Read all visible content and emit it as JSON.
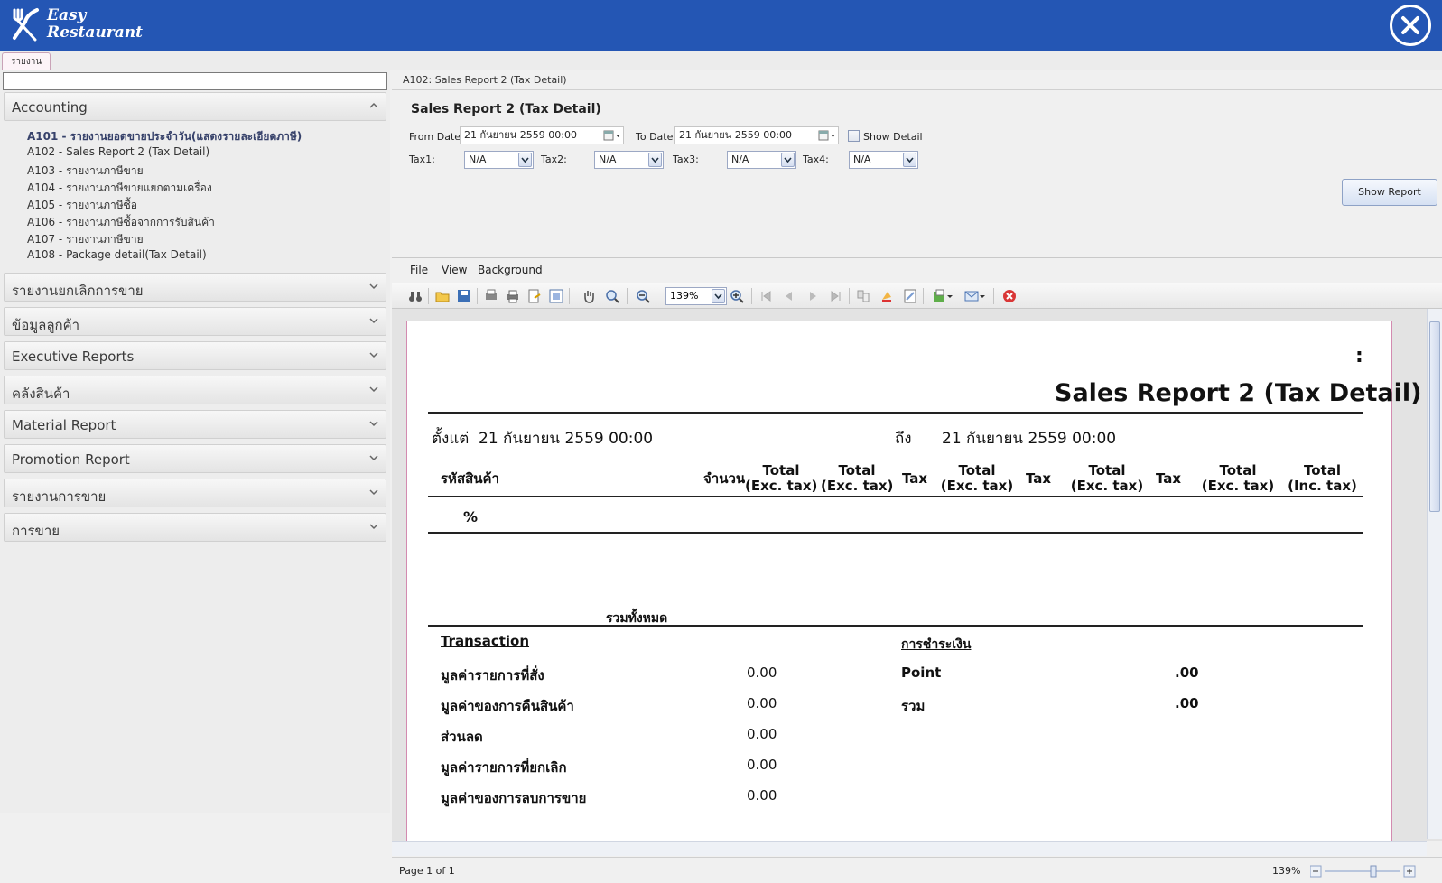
{
  "app": {
    "logo_line1": "Easy",
    "logo_line2": "Restaurant"
  },
  "tabs": [
    "รายงาน"
  ],
  "search": {
    "value": ""
  },
  "accordion": {
    "accounting": {
      "label": "Accounting",
      "items": [
        "A101 - รายงานยอดขายประจำวัน(แสดงรายละเอียดภาษี)",
        "A102 - Sales Report 2 (Tax Detail)",
        "A103 - รายงานภาษีขาย",
        "A104 - รายงานภาษีขายแยกตามเครื่อง",
        "A105 - รายงานภาษีซื้อ",
        "A106 - รายงานภาษีซื้อจากการรับสินค้า",
        "A107 - รายงานภาษีขาย",
        "A108 - Package detail(Tax Detail)"
      ]
    },
    "sections": [
      "รายงานยกเลิกการขาย",
      "ข้อมูลลูกค้า",
      "Executive Reports",
      "คลังสินค้า",
      "Material Report",
      "Promotion Report",
      "รายงานการขาย",
      "การขาย"
    ]
  },
  "report_header": {
    "breadcrumb": "A102: Sales Report 2 (Tax Detail)",
    "title": "Sales Report 2 (Tax Detail)",
    "from_label": "From Date:",
    "from_value": "21  กันยายน      2559  00:00",
    "to_label": "To Date:",
    "to_value": "21  กันยายน      2559  00:00",
    "show_detail_label": "Show Detail",
    "show_detail_checked": false,
    "tax1_label": "Tax1:",
    "tax1_value": "N/A",
    "tax2_label": "Tax2:",
    "tax2_value": "N/A",
    "tax3_label": "Tax3:",
    "tax3_value": "N/A",
    "tax4_label": "Tax4:",
    "tax4_value": "N/A",
    "show_report_button": "Show Report"
  },
  "viewer": {
    "menu": [
      "File",
      "View",
      "Background"
    ],
    "zoom_value": "139%",
    "status_page": "Page 1 of 1",
    "status_zoom": "139%"
  },
  "report": {
    "colon": ":",
    "title": "Sales Report 2 (Tax Detail)",
    "from_label": "ตั้งแต่",
    "from_value": "21 กันยายน 2559 00:00",
    "to_label": "ถึง",
    "to_value": "21 กันยายน 2559 00:00",
    "col_code": "รหัสสินค้า",
    "col_qty": "จำนวน",
    "col_total1a": "Total",
    "col_total1b": "(Exc. tax)",
    "col_total2a": "Total",
    "col_total2b": "(Exc. tax)",
    "col_tax1": "Tax",
    "col_total3a": "Total",
    "col_total3b": "(Exc. tax)",
    "col_tax2": "Tax",
    "col_total4a": "Total",
    "col_total4b": "(Exc. tax)",
    "col_tax3": "Tax",
    "col_total5a": "Total",
    "col_total5b": "(Exc. tax)",
    "col_total6a": "Total",
    "col_total6b": "(Inc. tax)",
    "percent": "%",
    "grand_total_label": "รวมทั้งหมด",
    "transaction_heading": "Transaction",
    "payment_heading": "การชำระเงิน",
    "lines": [
      {
        "label": "มูลค่ารายการที่สั่ง",
        "value": "0.00"
      },
      {
        "label": "มูลค่าของการคืนสินค้า",
        "value": "0.00"
      },
      {
        "label": "ส่วนลด",
        "value": "0.00"
      },
      {
        "label": "มูลค่ารายการที่ยกเลิก",
        "value": "0.00"
      },
      {
        "label": "มูลค่าของการลบการขาย",
        "value": "0.00"
      }
    ],
    "payments": [
      {
        "label": "Point",
        "value": ".00"
      },
      {
        "label": "รวม",
        "value": ".00"
      }
    ]
  }
}
